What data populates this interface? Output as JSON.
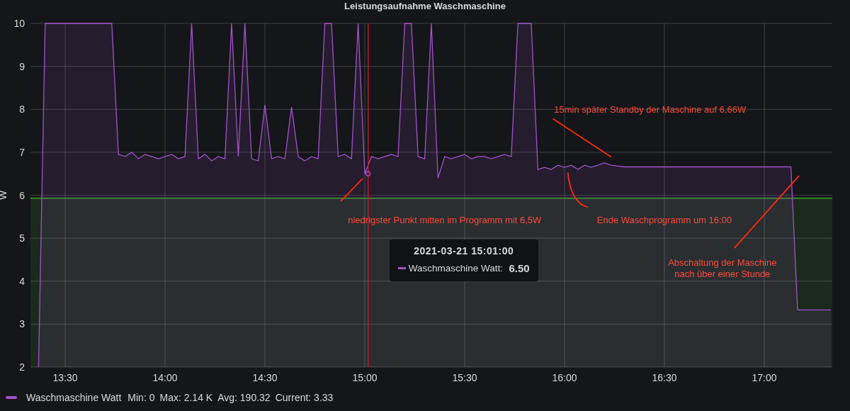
{
  "panel": {
    "title": "Leistungsaufnahme Waschmaschine"
  },
  "chart_data": {
    "type": "area",
    "ylabel": "W",
    "ylim": [
      2,
      10
    ],
    "grid": true,
    "yticks": [
      2,
      3,
      4,
      5,
      6,
      7,
      8,
      9,
      10
    ],
    "categories": [
      null,
      null,
      null,
      null,
      null,
      "13:30",
      null,
      null,
      null,
      null,
      null,
      null,
      null,
      null,
      null,
      null,
      null,
      null,
      null,
      null,
      "14:00",
      null,
      null,
      null,
      null,
      null,
      null,
      null,
      null,
      null,
      null,
      null,
      null,
      null,
      null,
      "14:30",
      null,
      null,
      null,
      null,
      null,
      null,
      null,
      null,
      null,
      null,
      null,
      null,
      null,
      null,
      "15:00",
      null,
      null,
      null,
      null,
      null,
      null,
      null,
      null,
      null,
      null,
      null,
      null,
      null,
      null,
      "15:30",
      null,
      null,
      null,
      null,
      null,
      null,
      null,
      null,
      null,
      null,
      null,
      null,
      null,
      null,
      "16:00",
      null,
      null,
      null,
      null,
      null,
      null,
      null,
      null,
      null,
      null,
      null,
      null,
      null,
      null,
      "16:30",
      null,
      null,
      null,
      null,
      null,
      null,
      null,
      null,
      null,
      null,
      null,
      null,
      null,
      null,
      "17:00",
      null,
      null,
      null,
      null,
      null,
      null,
      null,
      null,
      null,
      null
    ],
    "series": [
      {
        "name": "Waschmaschine Watt",
        "color": "#a352cc",
        "values": [
          null,
          2,
          10,
          10,
          10,
          10,
          10,
          10,
          10,
          10,
          10,
          10,
          10,
          6.95,
          6.9,
          7.0,
          6.85,
          6.95,
          6.9,
          6.85,
          6.9,
          6.95,
          6.85,
          6.9,
          10,
          6.85,
          6.95,
          6.8,
          6.9,
          6.85,
          10,
          6.9,
          10,
          6.85,
          6.8,
          8.1,
          6.85,
          6.9,
          6.85,
          8.05,
          6.9,
          6.8,
          6.9,
          6.85,
          10,
          10,
          6.9,
          6.95,
          6.85,
          10,
          6.5,
          6.9,
          6.85,
          6.9,
          6.95,
          6.9,
          10,
          10,
          6.9,
          6.85,
          10,
          6.4,
          6.9,
          6.85,
          6.9,
          6.95,
          6.85,
          6.9,
          6.9,
          6.85,
          6.9,
          6.95,
          6.9,
          10,
          10,
          10,
          6.6,
          6.65,
          6.6,
          6.7,
          6.65,
          6.7,
          6.6,
          6.7,
          6.65,
          6.7,
          6.75,
          6.7,
          6.68,
          6.66,
          6.66,
          6.66,
          6.66,
          6.66,
          6.66,
          6.66,
          6.66,
          6.66,
          6.66,
          6.66,
          6.66,
          6.66,
          6.66,
          6.66,
          6.66,
          6.66,
          6.66,
          6.66,
          6.66,
          6.66,
          6.66,
          6.66,
          6.66,
          6.66,
          6.66,
          3.33,
          3.33,
          3.33,
          3.33,
          3.33,
          3.33
        ]
      }
    ],
    "ref_lines": [
      {
        "axis": "y",
        "value": 5.93,
        "color": "#37872d"
      }
    ],
    "bands": [
      {
        "axis": "y",
        "from": 2,
        "to": 5.93,
        "color": "#37872d"
      }
    ],
    "annotations": [
      "15min später Standby der Maschine auf 6,66W",
      "niedrigster Punkt mitten im Programm mit 6,5W",
      "Ende Waschprogramm um 16:00",
      "Abschaltung der Maschine\nnach über einer Stunde"
    ]
  },
  "tooltip": {
    "time": "2021-03-21 15:01:00",
    "series": "Waschmaschine Watt:",
    "value": "6.50",
    "color": "#a352cc"
  },
  "legend": {
    "stats": [
      "Min: 0",
      "Max: 2.14 K",
      "Avg: 190.32",
      "Current: 3.33"
    ]
  }
}
